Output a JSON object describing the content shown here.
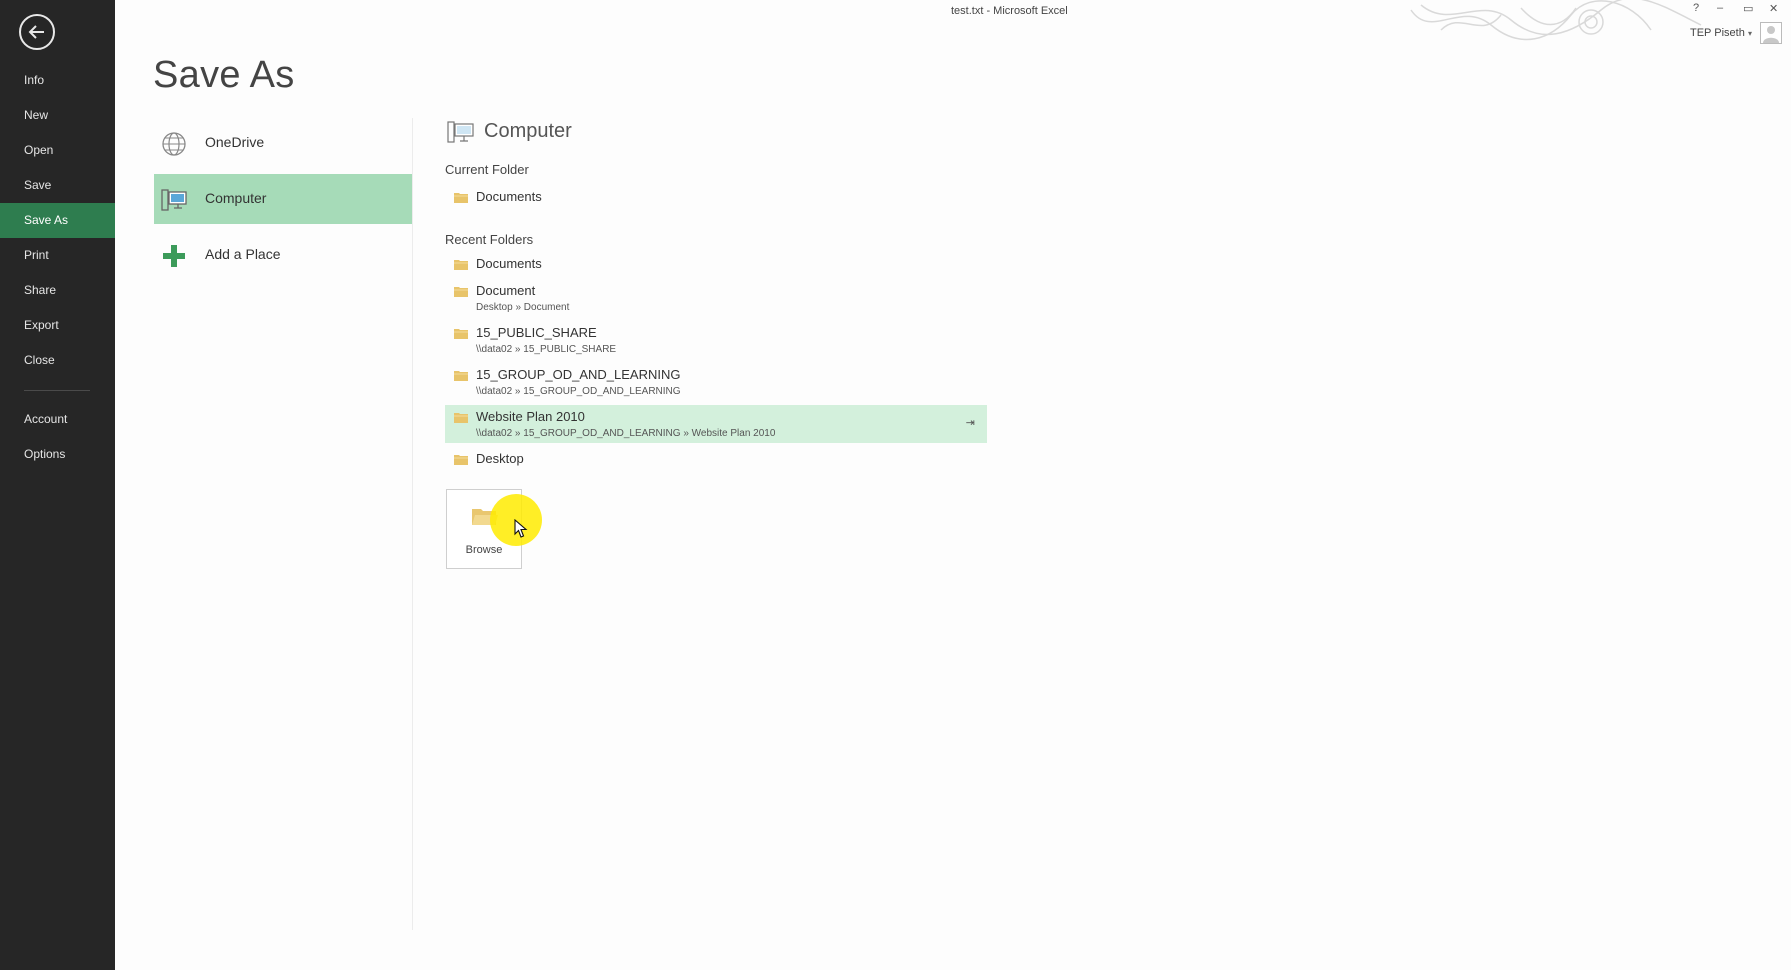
{
  "window": {
    "title": "test.txt - Microsoft Excel",
    "controls": {
      "help": "?",
      "minimize": "–",
      "restore": "▭",
      "close": "✕"
    },
    "user_name": "TEP Piseth",
    "user_caret": "▾"
  },
  "nav": {
    "items": [
      {
        "label": "Info",
        "active": false
      },
      {
        "label": "New",
        "active": false
      },
      {
        "label": "Open",
        "active": false
      },
      {
        "label": "Save",
        "active": false
      },
      {
        "label": "Save As",
        "active": true
      },
      {
        "label": "Print",
        "active": false
      },
      {
        "label": "Share",
        "active": false
      },
      {
        "label": "Export",
        "active": false
      },
      {
        "label": "Close",
        "active": false
      },
      {
        "label": "Account",
        "active": false
      },
      {
        "label": "Options",
        "active": false
      }
    ]
  },
  "page_title": "Save As",
  "places": [
    {
      "label": "OneDrive",
      "icon": "globe-icon",
      "active": false
    },
    {
      "label": "Computer",
      "icon": "computer-icon",
      "active": true
    },
    {
      "label": "Add a Place",
      "icon": "plus-icon",
      "active": false
    }
  ],
  "panel": {
    "title": "Computer",
    "current_folder_label": "Current Folder",
    "current_folder": {
      "name": "Documents"
    },
    "recent_folders_label": "Recent Folders",
    "recent_folders": [
      {
        "name": "Documents",
        "path": ""
      },
      {
        "name": "Document",
        "path": "Desktop » Document"
      },
      {
        "name": "15_PUBLIC_SHARE",
        "path": "\\\\data02 » 15_PUBLIC_SHARE"
      },
      {
        "name": "15_GROUP_OD_AND_LEARNING",
        "path": "\\\\data02 » 15_GROUP_OD_AND_LEARNING"
      },
      {
        "name": "Website Plan 2010",
        "path": "\\\\data02 » 15_GROUP_OD_AND_LEARNING » Website Plan 2010",
        "highlighted": true,
        "pin": "⇥"
      },
      {
        "name": "Desktop",
        "path": ""
      }
    ],
    "browse_label": "Browse"
  },
  "colors": {
    "nav_bg": "#262626",
    "nav_active": "#2e7d4f",
    "place_active": "#a6dbb8",
    "folder_highlight": "#d3f0dc",
    "folder_icon": "#e8c46a",
    "cursor_highlight": "#ffeb00"
  }
}
